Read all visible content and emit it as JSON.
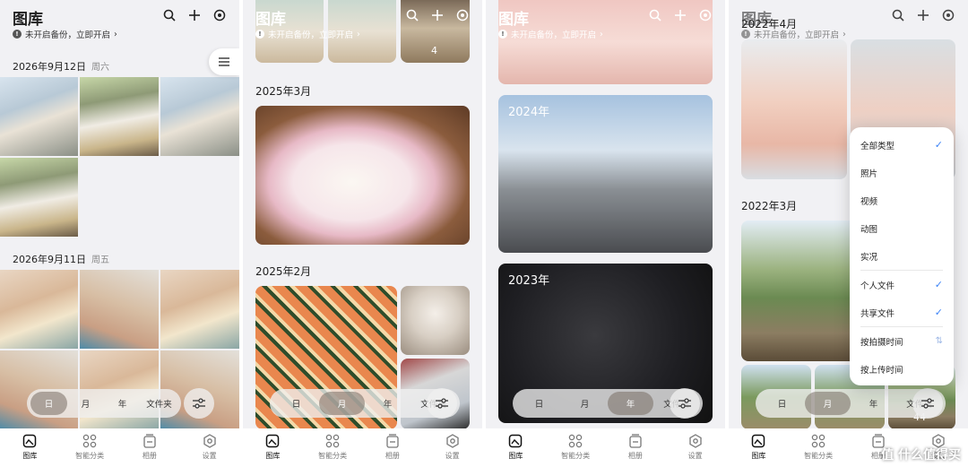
{
  "app": {
    "title": "图库",
    "backup_text": "未开启备份，立即开启",
    "backup_arrow": "›"
  },
  "panel1": {
    "date1": "2026年9月12日",
    "weekday1": "周六",
    "date2": "2026年9月11日",
    "weekday2": "周五"
  },
  "panel2": {
    "year1": "2025年3月",
    "year2": "2025年2月",
    "badge": "4"
  },
  "panel3": {
    "year1": "2024年",
    "year2": "2023年"
  },
  "panel4": {
    "header1": "2022年4月",
    "header2": "2022年3月",
    "count": "44"
  },
  "zoom_levels": [
    "日",
    "月",
    "年",
    "文件夹"
  ],
  "bottom_nav": [
    "图库",
    "智能分类",
    "相册",
    "设置"
  ],
  "filter_menu": {
    "items": [
      "全部类型",
      "照片",
      "视频",
      "动图",
      "实况",
      "个人文件",
      "共享文件",
      "按拍摄时间",
      "按上传时间"
    ],
    "checked": [
      true,
      false,
      false,
      false,
      false,
      true,
      true,
      false,
      false
    ]
  },
  "watermark": "值 什么值得买",
  "colors": {
    "accent": "#3b82f6",
    "nav_active": "#111111",
    "nav_inactive": "#777777"
  }
}
